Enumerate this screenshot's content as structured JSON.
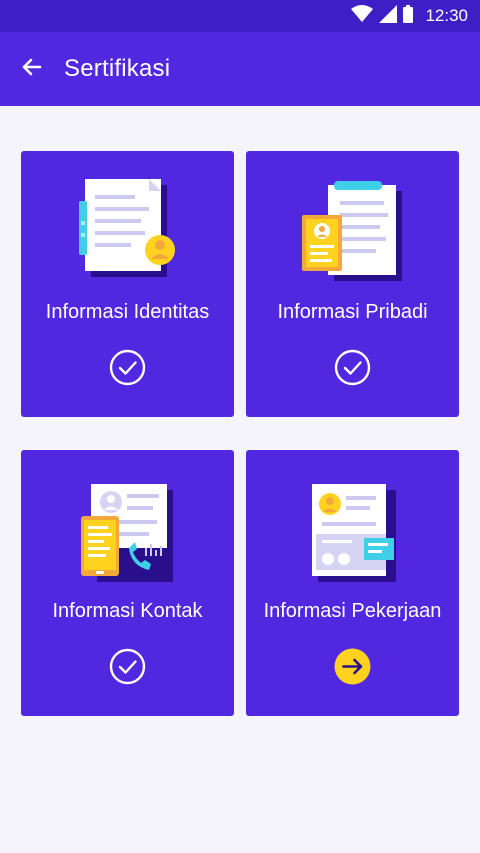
{
  "status_bar": {
    "time": "12:30",
    "icons": [
      "wifi-icon",
      "signal-icon",
      "battery-icon"
    ]
  },
  "app_bar": {
    "title": "Sertifikasi",
    "back_icon": "arrow-left-icon"
  },
  "cards": [
    {
      "label": "Informasi Identitas",
      "status": "completed",
      "status_icon": "check-circle-icon"
    },
    {
      "label": "Informasi Pribadi",
      "status": "completed",
      "status_icon": "check-circle-icon"
    },
    {
      "label": "Informasi Kontak",
      "status": "completed",
      "status_icon": "check-circle-icon"
    },
    {
      "label": "Informasi Pekerjaan",
      "status": "next",
      "status_icon": "arrow-right-circle-icon"
    }
  ],
  "colors": {
    "primary": "#5128e0",
    "status_bar": "#3d1fc6",
    "background": "#f5f4fa",
    "accent_yellow": "#ffd21f",
    "accent_cyan": "#3fd0e8"
  }
}
